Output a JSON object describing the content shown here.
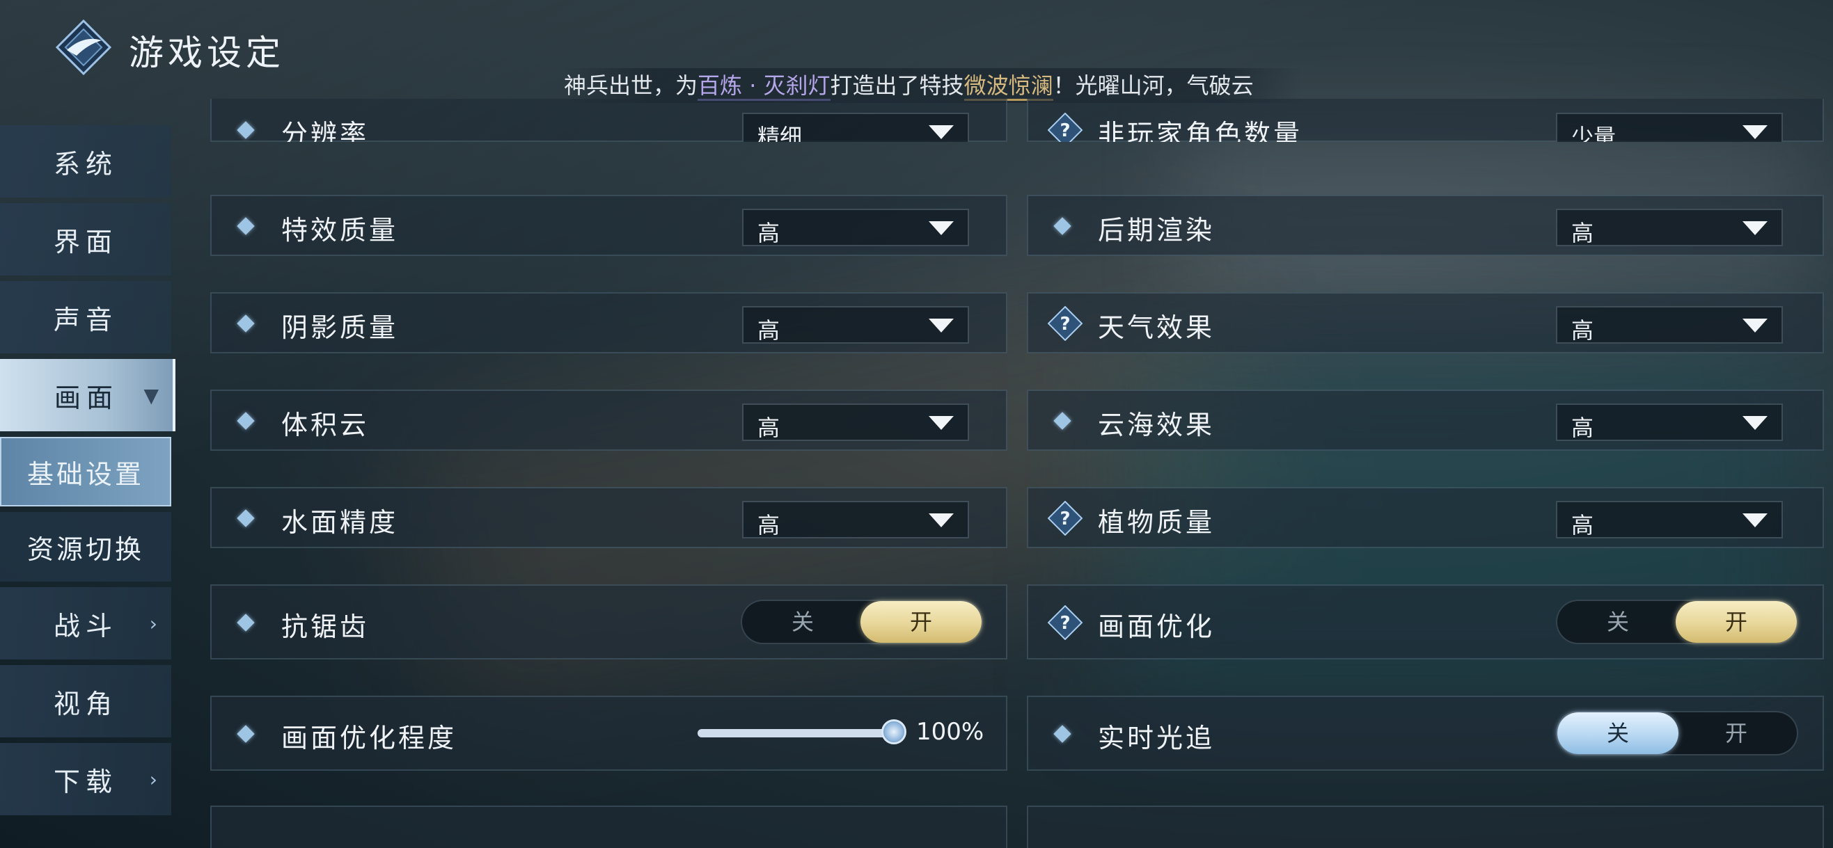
{
  "header": {
    "title": "游戏设定",
    "ticker": {
      "prefix": "神兵出世，为",
      "item": "百炼 · 灭刹灯",
      "middle": "打造出了特技",
      "skill": "微波惊澜",
      "suffix": "！光曜山河，气破云"
    }
  },
  "sidebar": {
    "items": [
      {
        "label": "系统"
      },
      {
        "label": "界面"
      },
      {
        "label": "声音"
      },
      {
        "label": "画面",
        "active": true
      },
      {
        "label": "战斗"
      },
      {
        "label": "视角"
      },
      {
        "label": "下载"
      }
    ],
    "subitems": [
      {
        "label": "基础设置",
        "selected": true
      },
      {
        "label": "资源切换"
      }
    ]
  },
  "settings": {
    "resolution": {
      "label": "分辨率",
      "value": "精细"
    },
    "npc_count": {
      "label": "非玩家角色数量",
      "value": "少量"
    },
    "effects_quality": {
      "label": "特效质量",
      "value": "高"
    },
    "post_processing": {
      "label": "后期渲染",
      "value": "高"
    },
    "shadow_quality": {
      "label": "阴影质量",
      "value": "高"
    },
    "weather_effects": {
      "label": "天气效果",
      "value": "高"
    },
    "volumetric_clouds": {
      "label": "体积云",
      "value": "高"
    },
    "cloud_sea": {
      "label": "云海效果",
      "value": "高"
    },
    "water_precision": {
      "label": "水面精度",
      "value": "高"
    },
    "vegetation_quality": {
      "label": "植物质量",
      "value": "高"
    },
    "antialiasing": {
      "label": "抗锯齿",
      "off_label": "关",
      "on_label": "开",
      "state": "on"
    },
    "image_optimization": {
      "label": "画面优化",
      "off_label": "关",
      "on_label": "开",
      "state": "on"
    },
    "optimization_level": {
      "label": "画面优化程度",
      "value_text": "100%",
      "value": 1.0
    },
    "ray_tracing": {
      "label": "实时光追",
      "off_label": "关",
      "on_label": "开",
      "state": "off"
    }
  },
  "colors": {
    "toggle_on_gold": "#e8d79a",
    "toggle_active_blue": "#b8d8f2",
    "diamond_icon": "#9fc5e4"
  },
  "icons": {
    "setting_marker": "diamond-icon",
    "help": "help-question-icon",
    "dropdown": "caret-down-icon",
    "submenu": "chevron-right-icon"
  }
}
